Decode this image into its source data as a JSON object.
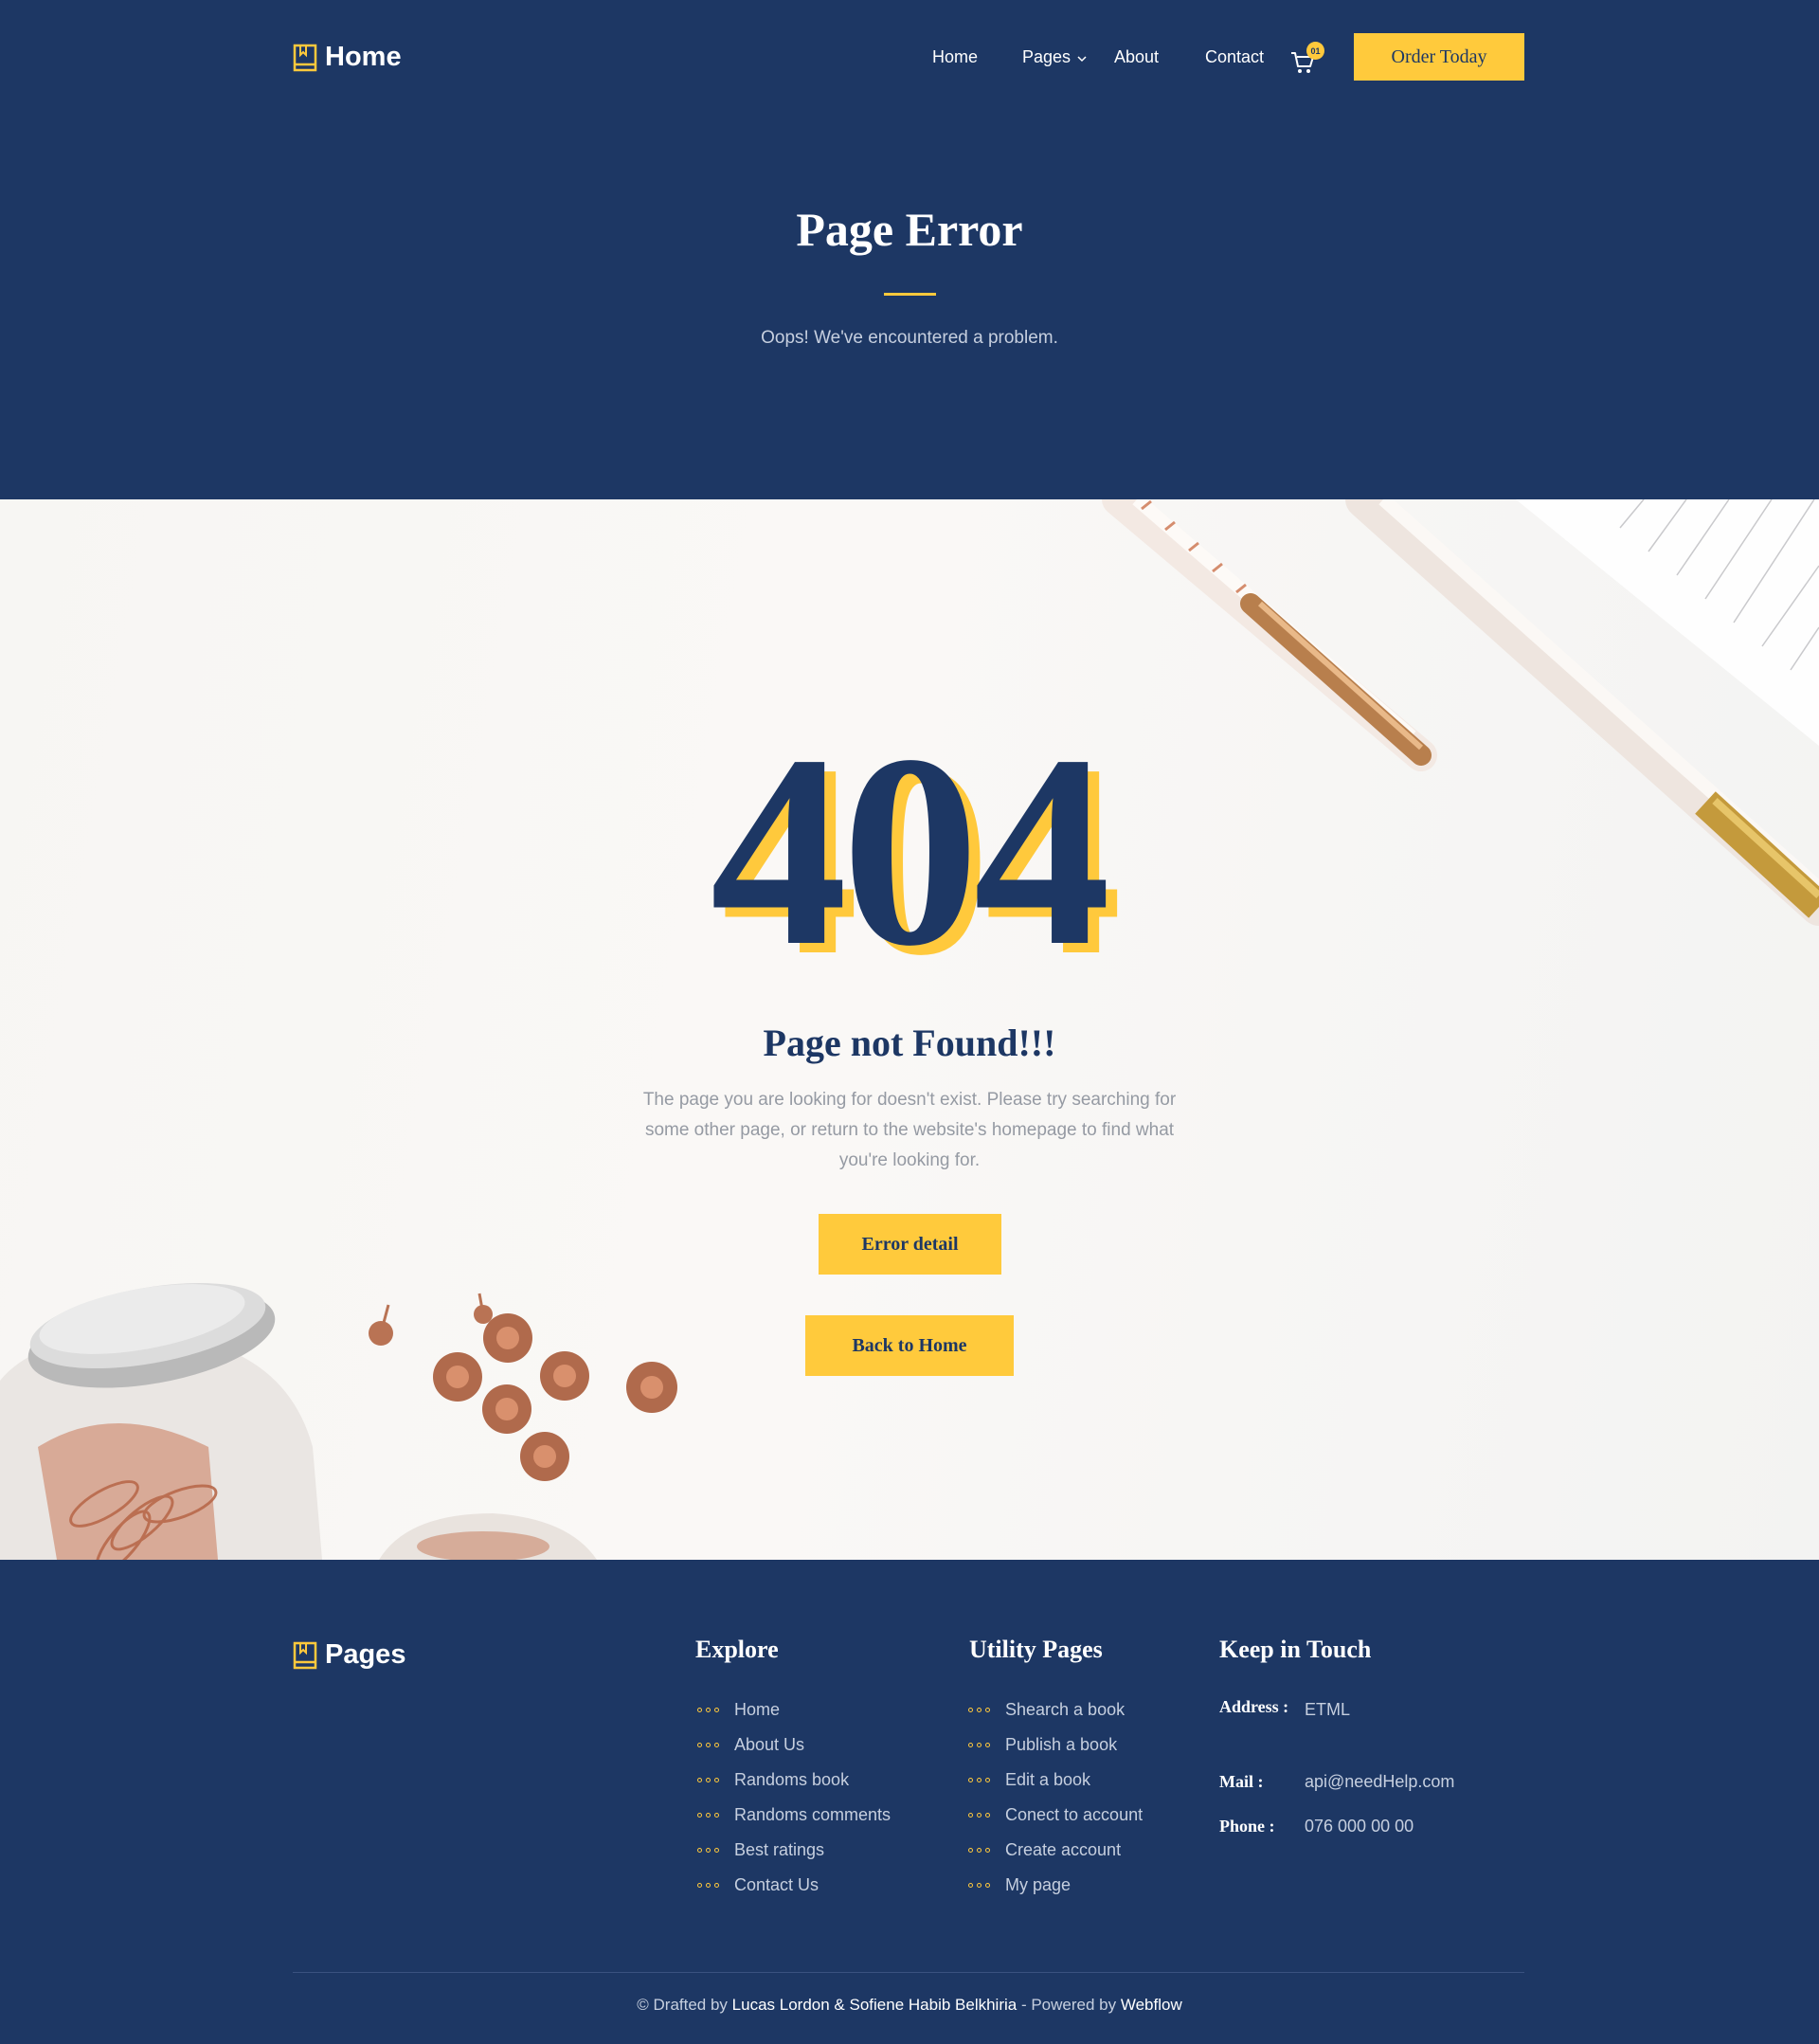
{
  "header": {
    "brand": "Home",
    "nav": [
      {
        "label": "Home"
      },
      {
        "label": "Pages"
      },
      {
        "label": "About"
      },
      {
        "label": "Contact"
      }
    ],
    "cart_count": "01",
    "order_button": "Order Today"
  },
  "hero": {
    "title": "Page Error",
    "subtitle": "Oops! We've encountered a problem."
  },
  "error": {
    "code": "404",
    "title": "Page not Found!!!",
    "description": "The page you are looking for doesn't exist. Please try searching for some other page, or return to the website's homepage to find what you're looking for.",
    "detail_button": "Error detail",
    "home_button": "Back to Home"
  },
  "footer": {
    "brand": "Pages",
    "explore": {
      "title": "Explore",
      "items": [
        "Home",
        "About Us",
        "Randoms book",
        "Randoms comments",
        "Best ratings",
        "Contact Us"
      ]
    },
    "utility": {
      "title": "Utility Pages",
      "items": [
        "Shearch a book",
        "Publish a book",
        "Edit a book",
        "Conect to account",
        "Create account",
        "My page"
      ]
    },
    "contact": {
      "title": "Keep in Touch",
      "address_label": "Address :",
      "address": "ETML",
      "mail_label": "Mail :",
      "mail": "api@needHelp.com",
      "phone_label": "Phone :",
      "phone": "076 000 00 00"
    },
    "copyright": {
      "symbol": "©",
      "drafted_by": "Drafted by",
      "author1": "Lucas Lordon &",
      "author2": "Sofiene Habib Belkhiria",
      "powered_by": "- Powered by",
      "platform": "Webflow"
    }
  },
  "colors": {
    "navy": "#1d3764",
    "accent": "#ffca3c",
    "muted_text": "#c6cfdf"
  }
}
